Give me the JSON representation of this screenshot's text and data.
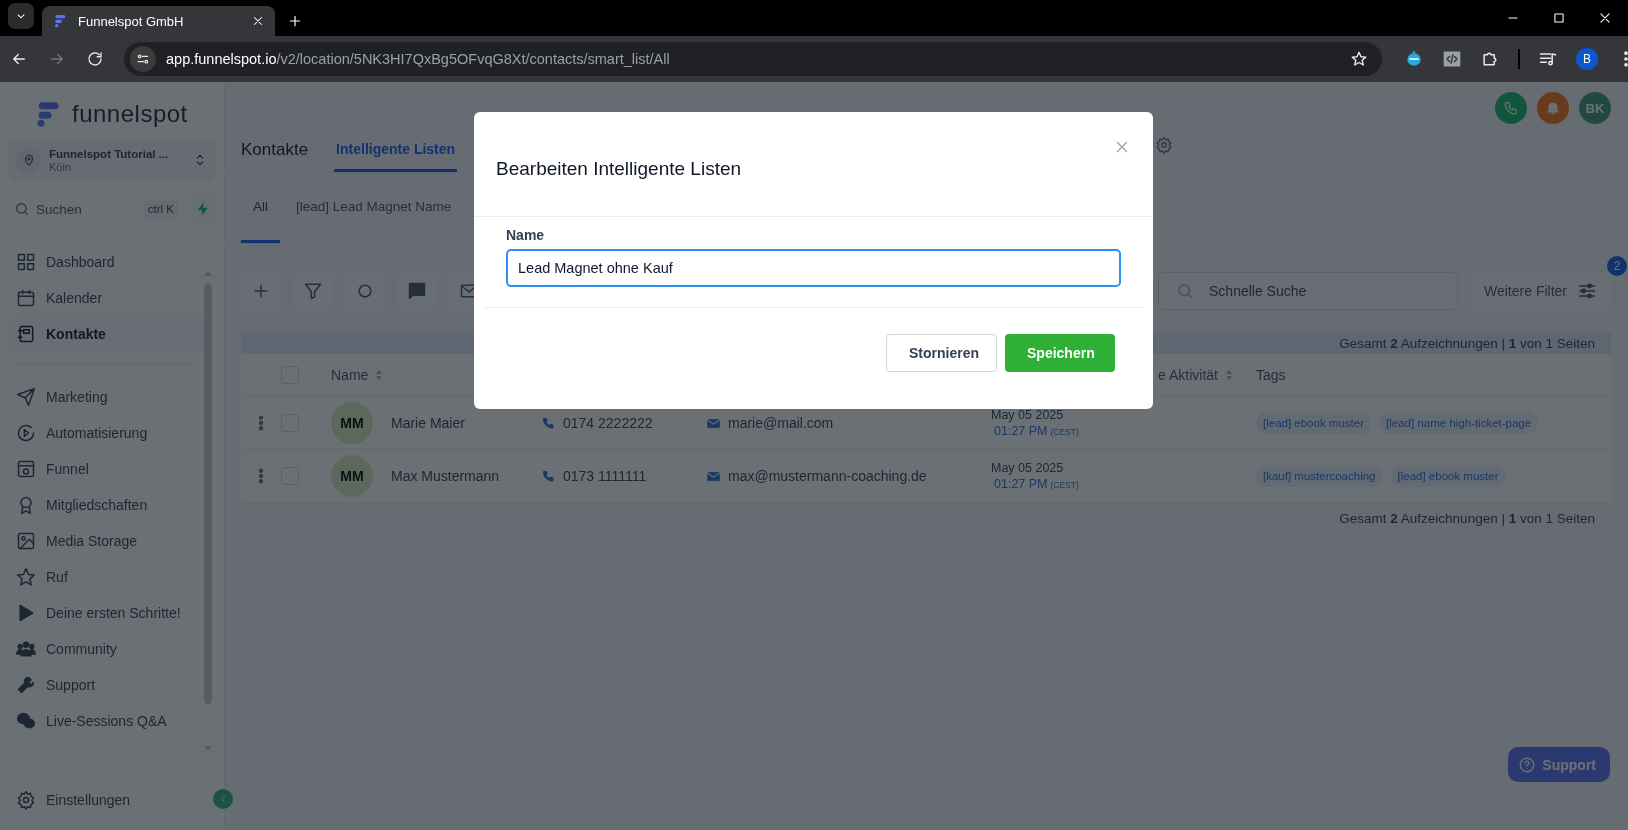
{
  "browser": {
    "tab_title": "Funnelspot GmbH",
    "url": {
      "host": "app.funnelspot.io",
      "path": "/v2/location/5NK3HI7QxBg5OFvqG8Xt/contacts/smart_list/All"
    },
    "profile_initial": "B"
  },
  "sidebar": {
    "logo": "funnelspot",
    "location": {
      "name": "Funnelspot Tutorial ...",
      "city": "Köln"
    },
    "search": {
      "placeholder": "Suchen",
      "shortcut": "ctrl K"
    },
    "groups": [
      [
        {
          "label": "Dashboard",
          "selected": false
        },
        {
          "label": "Kalender",
          "selected": false
        },
        {
          "label": "Kontakte",
          "selected": true
        }
      ],
      [
        {
          "label": "Marketing",
          "selected": false
        },
        {
          "label": "Automatisierung",
          "selected": false
        },
        {
          "label": "Funnel",
          "selected": false
        },
        {
          "label": "Mitgliedschaften",
          "selected": false
        },
        {
          "label": "Media Storage",
          "selected": false
        },
        {
          "label": "Ruf",
          "selected": false
        },
        {
          "label": "Deine ersten Schritte!",
          "selected": false
        },
        {
          "label": "Community",
          "selected": false
        },
        {
          "label": "Support",
          "selected": false
        },
        {
          "label": "Live-Sessions Q&A",
          "selected": false
        }
      ]
    ],
    "settings": "Einstellungen"
  },
  "header": {
    "avatar_initials": "BK",
    "title": "Kontakte",
    "tabs": [
      {
        "label": "Intelligente Listen",
        "selected": true
      }
    ]
  },
  "smart_lists": [
    {
      "label": "All",
      "selected": true
    },
    {
      "label": "[lead] Lead Magnet Name",
      "selected": false
    }
  ],
  "toolbar": {
    "search_placeholder": "Schnelle Suche",
    "filter_button": "Weitere Filter",
    "filter_count": "2"
  },
  "pagination_top": "Gesamt **2** Aufzeichnungen | **1** von 1 Seiten",
  "table": {
    "select_all_checked": false,
    "columns": {
      "name": "Name",
      "column_5": "e Aktivität",
      "tags": "Tags"
    },
    "rows": [
      {
        "initials": "MM",
        "name": "Marie Maier",
        "phone": "0174 2222222",
        "email": "marie@mail.com",
        "date": "May 05 2025",
        "time": "01:27 PM",
        "timezone": "(CEST)",
        "tags": [
          "[lead] ebook muster",
          "[lead] name high-ticket-page"
        ],
        "checked": false
      },
      {
        "initials": "MM",
        "name": "Max Mustermann",
        "phone": "0173 1111111",
        "email": "max@mustermann-coaching.de",
        "date": "May 05 2025",
        "time": "01:27 PM",
        "timezone": "(CEST)",
        "tags": [
          "[kauf] mustercoaching",
          "[lead] ebook muster"
        ],
        "checked": false
      }
    ]
  },
  "pagination_bottom": "Gesamt **2** Aufzeichnungen | **1** von 1 Seiten",
  "dialog": {
    "title": "Bearbeiten Intelligente Listen",
    "field_label": "Name",
    "field_value": "Lead Magnet ohne Kauf",
    "cancel": "Stornieren",
    "save": "Speichern"
  },
  "support_button": "Support"
}
